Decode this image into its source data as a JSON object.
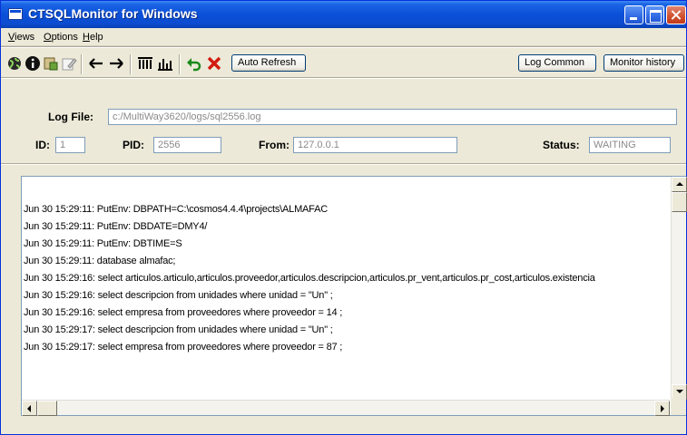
{
  "window": {
    "title": "CTSQLMonitor for Windows"
  },
  "menu": {
    "views": "Views",
    "options": "Options",
    "help": "Help"
  },
  "toolbar": {
    "icons": [
      "globe-icon",
      "info-icon",
      "database-icon",
      "edit-icon",
      "arrow-left-icon",
      "arrow-right-icon",
      "column-chart-icon",
      "bar-chart-icon",
      "undo-icon",
      "delete-icon"
    ],
    "auto_refresh": "Auto Refresh",
    "log_common": "Log Common",
    "monitor_history": "Monitor history"
  },
  "info": {
    "log_file_label": "Log File:",
    "log_file_value": "c:/MultiWay3620/logs/sql2556.log",
    "id_label": "ID:",
    "id_value": "1",
    "pid_label": "PID:",
    "pid_value": "2556",
    "from_label": "From:",
    "from_value": "127.0.0.1",
    "status_label": "Status:",
    "status_value": "WAITING"
  },
  "log": {
    "lines": [
      "Jun 30 15:29:11: PutEnv: DBPATH=C:\\cosmos4.4.4\\projects\\ALMAFAC",
      "Jun 30 15:29:11: PutEnv: DBDATE=DMY4/",
      "Jun 30 15:29:11: PutEnv: DBTIME=S",
      "Jun 30 15:29:11: database almafac;",
      "Jun 30 15:29:16: select articulos.articulo,articulos.proveedor,articulos.descripcion,articulos.pr_vent,articulos.pr_cost,articulos.existencia",
      "Jun 30 15:29:16: select descripcion from unidades where unidad = \"Un\" ;",
      "Jun 30 15:29:16: select empresa from proveedores where proveedor = 14 ;",
      "Jun 30 15:29:17: select descripcion from unidades where unidad = \"Un\" ;",
      "Jun 30 15:29:17: select empresa from proveedores where proveedor = 87 ;"
    ]
  }
}
